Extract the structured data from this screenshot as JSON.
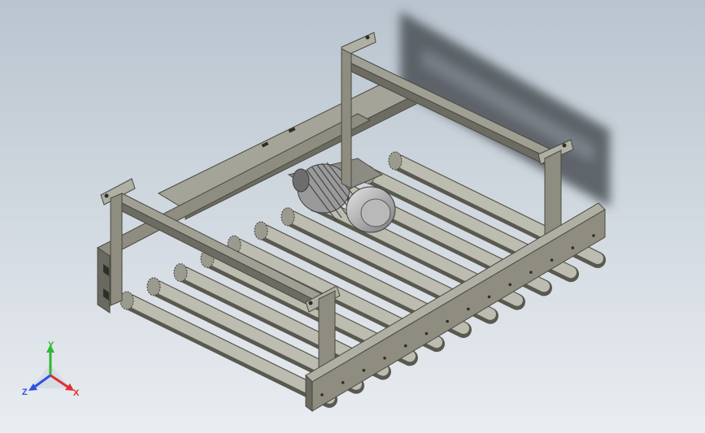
{
  "viewport": {
    "background_top": "#b9c4cf",
    "background_bottom": "#e9edf1",
    "part_color": "#8e8d80",
    "part_dark": "#5c5b52",
    "part_light": "#b5b4a8",
    "shadow_color": "#3a3f45"
  },
  "triad": {
    "x_label": "X",
    "y_label": "Y",
    "z_label": "Z",
    "x_color": "#e03030",
    "y_color": "#2fb82f",
    "z_color": "#3050e0"
  },
  "model": {
    "roller_count": 11,
    "motor_icon": "gear-motor-icon"
  }
}
